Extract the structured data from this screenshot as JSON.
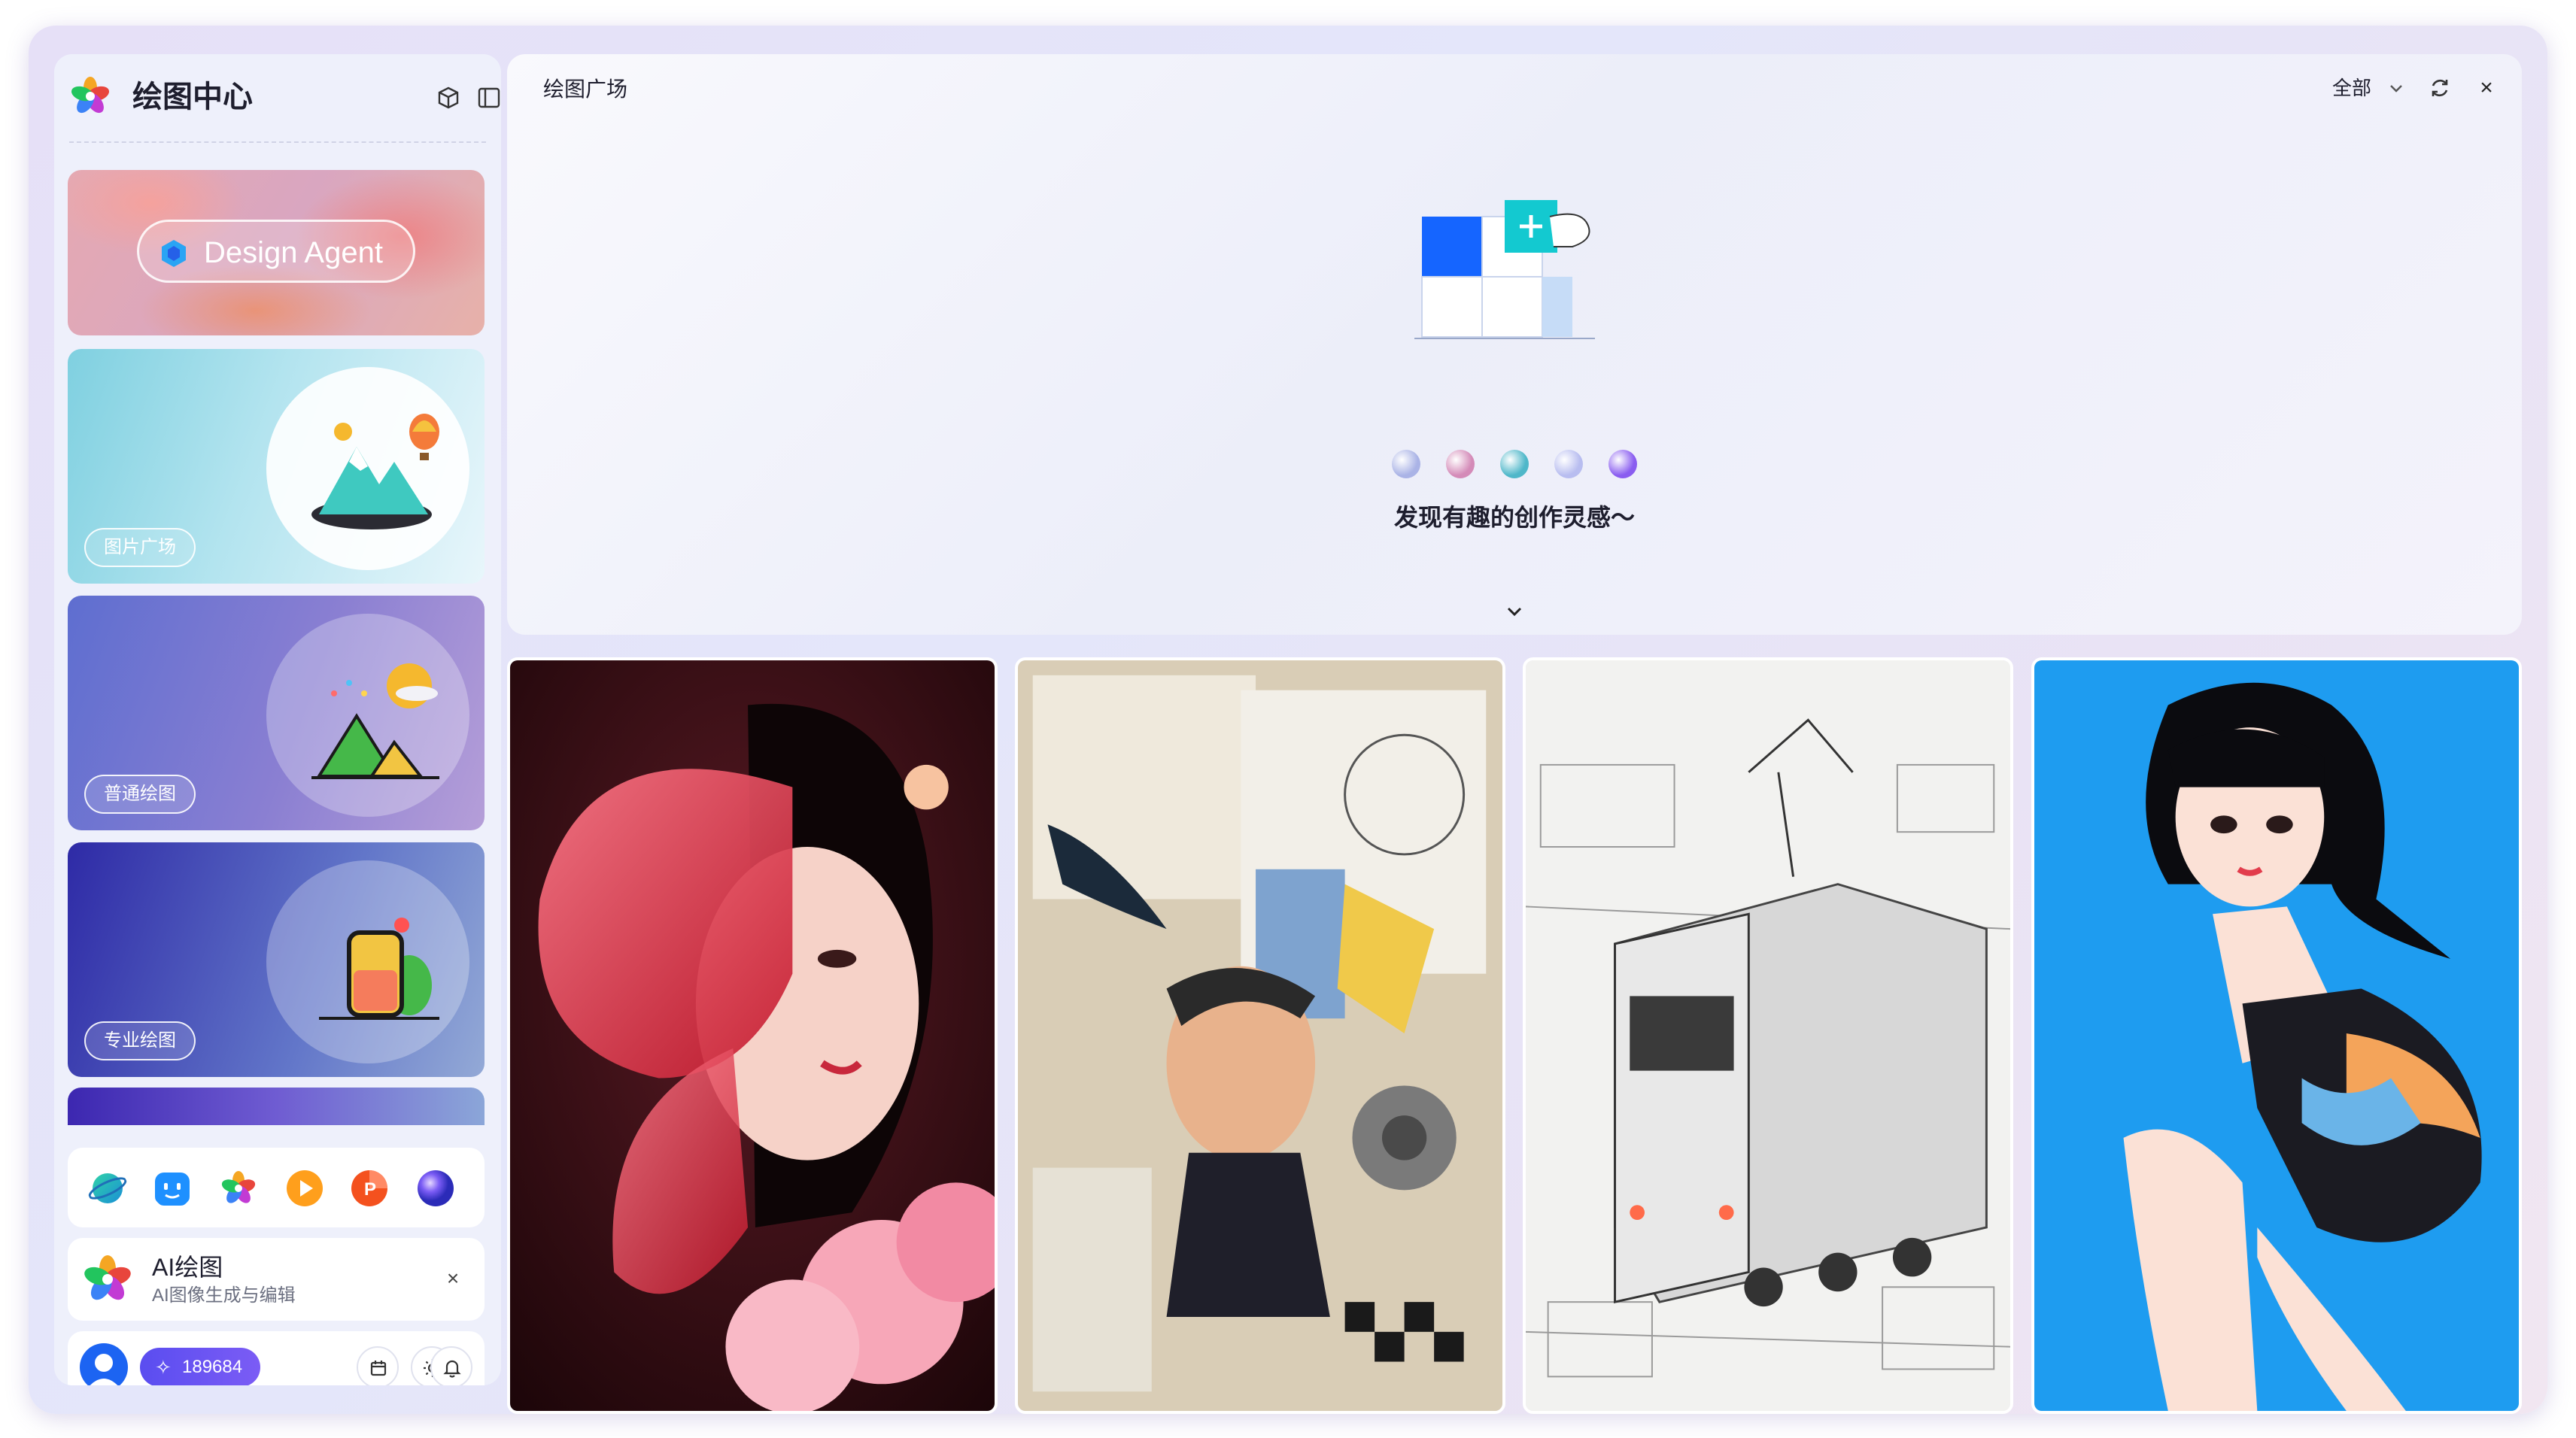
{
  "sidebar": {
    "app_title": "绘图中心",
    "header_icons": [
      "cube-icon",
      "panel-toggle-icon"
    ],
    "cards": {
      "agent": {
        "label": "Design Agent",
        "icon": "hexagon-icon"
      },
      "plaza": {
        "tag": "图片广场"
      },
      "normal": {
        "tag": "普通绘图"
      },
      "pro": {
        "tag": "专业绘图"
      }
    },
    "apps": [
      "planet-icon",
      "robot-icon",
      "flower-icon",
      "play-icon",
      "presentation-icon",
      "orb-icon"
    ],
    "ai_item": {
      "title": "AI绘图",
      "subtitle": "AI图像生成与编辑",
      "close": "×"
    },
    "user": {
      "points": "189684",
      "icons": [
        "calendar-icon",
        "sun-icon",
        "bell-icon"
      ]
    }
  },
  "main": {
    "title": "绘图广场",
    "filter": {
      "selected": "全部"
    },
    "close": "×",
    "tagline": "发现有趣的创作灵感～",
    "dot_colors": [
      "#aab3e6",
      "#d48bb8",
      "#4fb7c9",
      "#b8bdf0",
      "#8a5df0"
    ]
  },
  "gallery": {
    "items": [
      {
        "name": "butterfly-woman-image"
      },
      {
        "name": "collage-man-image"
      },
      {
        "name": "train-sketch-image"
      },
      {
        "name": "anime-girl-image"
      }
    ]
  }
}
